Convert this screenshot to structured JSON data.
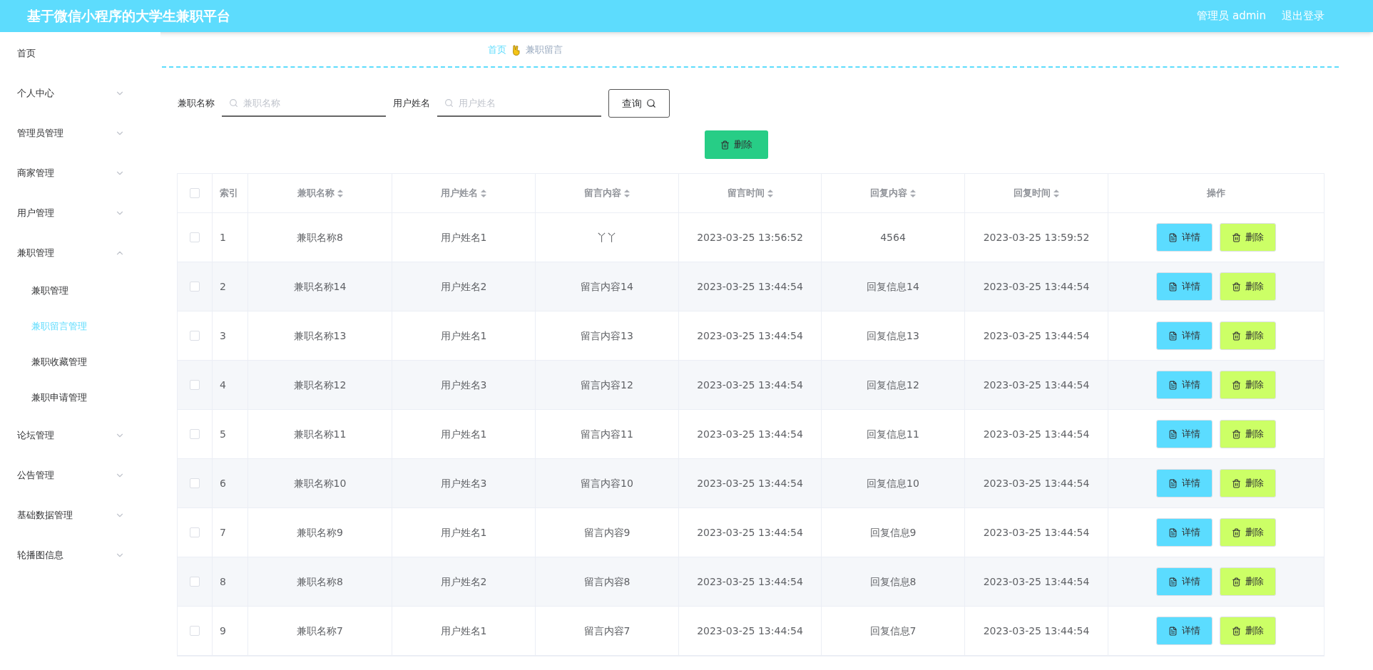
{
  "header": {
    "title": "基于微信小程序的大学生兼职平台",
    "user": "管理员 admin",
    "logout": "退出登录"
  },
  "sidebar": {
    "items": [
      {
        "kind": "link",
        "label": "首页",
        "selected": false
      },
      {
        "kind": "group",
        "label": "个人中心",
        "expanded": false,
        "selected": false
      },
      {
        "kind": "group",
        "label": "管理员管理",
        "expanded": false,
        "selected": false
      },
      {
        "kind": "group",
        "label": "商家管理",
        "expanded": false,
        "selected": false
      },
      {
        "kind": "group",
        "label": "用户管理",
        "expanded": false,
        "selected": false
      },
      {
        "kind": "group",
        "label": "兼职管理",
        "expanded": true,
        "selected": false,
        "children": [
          {
            "label": "兼职管理",
            "selected": false
          },
          {
            "label": "兼职留言管理",
            "selected": true
          },
          {
            "label": "兼职收藏管理",
            "selected": false
          },
          {
            "label": "兼职申请管理",
            "selected": false
          }
        ]
      },
      {
        "kind": "group",
        "label": "论坛管理",
        "expanded": false,
        "selected": false
      },
      {
        "kind": "group",
        "label": "公告管理",
        "expanded": false,
        "selected": false
      },
      {
        "kind": "group",
        "label": "基础数据管理",
        "expanded": false,
        "selected": false
      },
      {
        "kind": "group",
        "label": "轮播图信息",
        "expanded": false,
        "selected": false
      }
    ]
  },
  "breadcrumb": [
    {
      "label": "首页",
      "link": true
    },
    {
      "label": "兼职留言",
      "link": false
    }
  ],
  "search": {
    "fields": [
      {
        "label": "兼职名称",
        "placeholder": "兼职名称"
      },
      {
        "label": "用户姓名",
        "placeholder": "用户姓名"
      }
    ],
    "button": "查询"
  },
  "bulk_delete": "删除",
  "table": {
    "select_all": {
      "checked": false
    },
    "columns": [
      {
        "label": "索引",
        "sortable": false
      },
      {
        "label": "兼职名称",
        "sortable": true
      },
      {
        "label": "用户姓名",
        "sortable": true
      },
      {
        "label": "留言内容",
        "sortable": true
      },
      {
        "label": "留言时间",
        "sortable": true
      },
      {
        "label": "回复内容",
        "sortable": true
      },
      {
        "label": "回复时间",
        "sortable": true
      },
      {
        "label": "操作",
        "sortable": false
      }
    ],
    "rows": [
      {
        "checked": false,
        "cells": [
          "1",
          "兼职名称8",
          "用户姓名1",
          "丫丫",
          "2023-03-25 13:56:52",
          "4564",
          "2023-03-25 13:59:52"
        ],
        "actions": [
          "详情",
          "删除"
        ]
      },
      {
        "checked": false,
        "cells": [
          "2",
          "兼职名称14",
          "用户姓名2",
          "留言内容14",
          "2023-03-25 13:44:54",
          "回复信息14",
          "2023-03-25 13:44:54"
        ],
        "actions": [
          "详情",
          "删除"
        ]
      },
      {
        "checked": false,
        "cells": [
          "3",
          "兼职名称13",
          "用户姓名1",
          "留言内容13",
          "2023-03-25 13:44:54",
          "回复信息13",
          "2023-03-25 13:44:54"
        ],
        "actions": [
          "详情",
          "删除"
        ]
      },
      {
        "checked": false,
        "cells": [
          "4",
          "兼职名称12",
          "用户姓名3",
          "留言内容12",
          "2023-03-25 13:44:54",
          "回复信息12",
          "2023-03-25 13:44:54"
        ],
        "actions": [
          "详情",
          "删除"
        ]
      },
      {
        "checked": false,
        "cells": [
          "5",
          "兼职名称11",
          "用户姓名1",
          "留言内容11",
          "2023-03-25 13:44:54",
          "回复信息11",
          "2023-03-25 13:44:54"
        ],
        "actions": [
          "详情",
          "删除"
        ]
      },
      {
        "checked": false,
        "cells": [
          "6",
          "兼职名称10",
          "用户姓名3",
          "留言内容10",
          "2023-03-25 13:44:54",
          "回复信息10",
          "2023-03-25 13:44:54"
        ],
        "actions": [
          "详情",
          "删除"
        ]
      },
      {
        "checked": false,
        "cells": [
          "7",
          "兼职名称9",
          "用户姓名1",
          "留言内容9",
          "2023-03-25 13:44:54",
          "回复信息9",
          "2023-03-25 13:44:54"
        ],
        "actions": [
          "详情",
          "删除"
        ]
      },
      {
        "checked": false,
        "cells": [
          "8",
          "兼职名称8",
          "用户姓名2",
          "留言内容8",
          "2023-03-25 13:44:54",
          "回复信息8",
          "2023-03-25 13:44:54"
        ],
        "actions": [
          "详情",
          "删除"
        ]
      },
      {
        "checked": false,
        "cells": [
          "9",
          "兼职名称7",
          "用户姓名1",
          "留言内容7",
          "2023-03-25 13:44:54",
          "回复信息7",
          "2023-03-25 13:44:54"
        ],
        "actions": [
          "详情",
          "删除"
        ]
      }
    ]
  }
}
